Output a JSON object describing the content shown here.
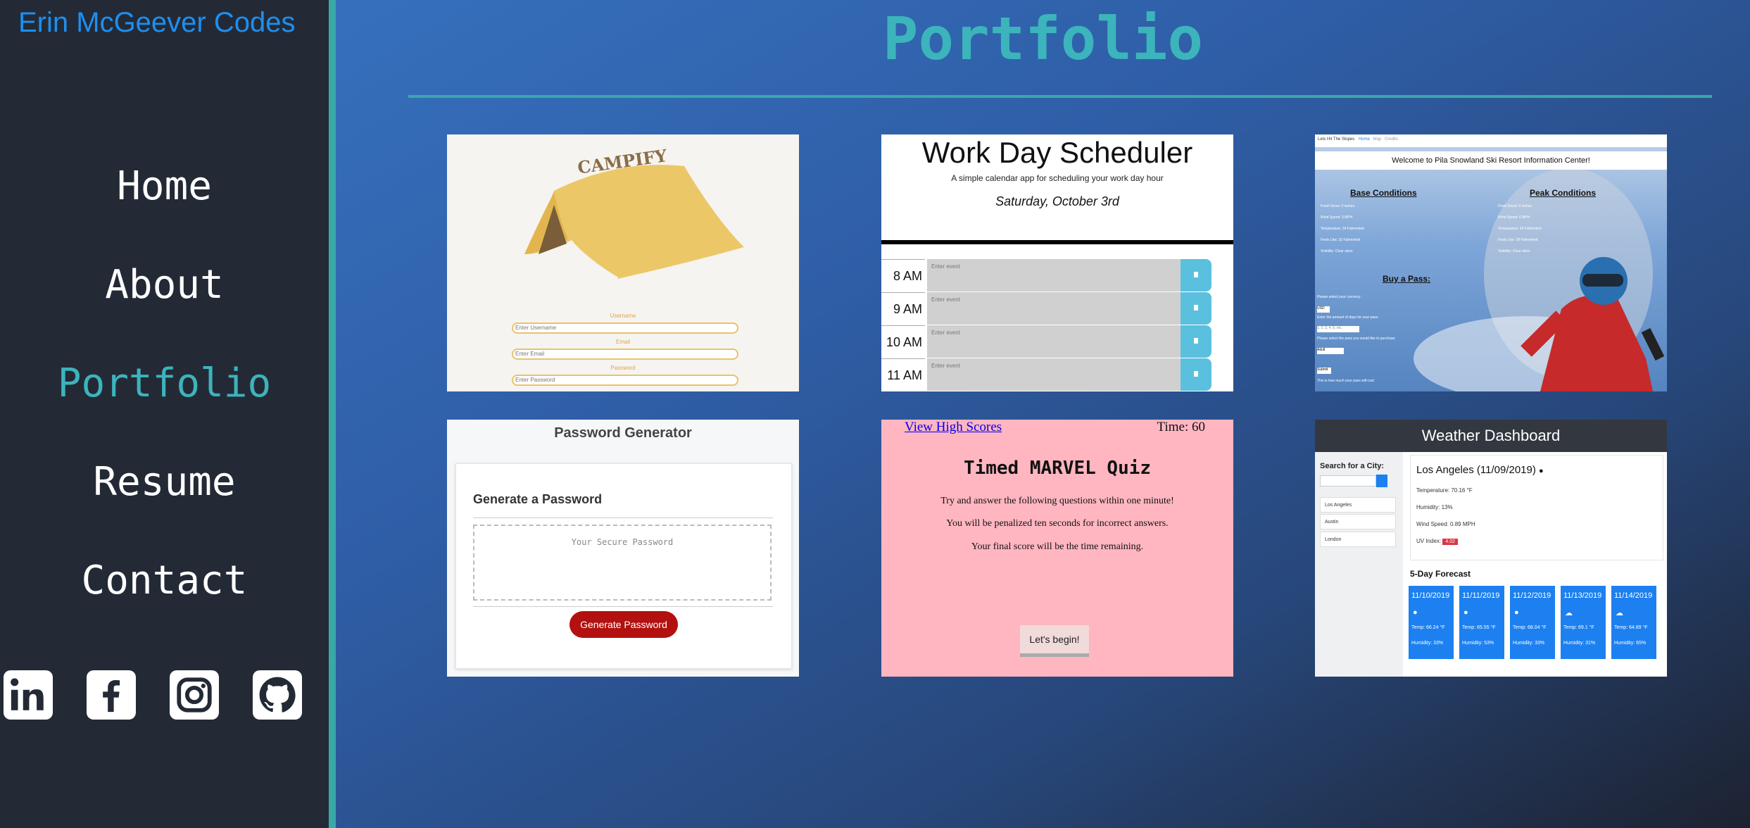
{
  "sidebar": {
    "brand": "Erin McGeever Codes",
    "nav": [
      "Home",
      "About",
      "Portfolio",
      "Resume",
      "Contact"
    ],
    "active": "Portfolio",
    "socials": [
      "linkedin-icon",
      "facebook-icon",
      "instagram-icon",
      "github-icon"
    ]
  },
  "main": {
    "title": "Portfolio"
  },
  "colors": {
    "accent": "#3cb4bc",
    "brand": "#1d8ff0",
    "sidebar_bg": "#232a36"
  },
  "projects": {
    "campify": {
      "logo_text": "CAMPIFY",
      "username_label": "Username",
      "username_placeholder": "Enter Username",
      "email_label": "Email",
      "email_placeholder": "Enter Email",
      "password_label": "Password",
      "password_placeholder": "Enter Password"
    },
    "scheduler": {
      "title": "Work Day Scheduler",
      "subtitle": "A simple calendar app for scheduling your work day hour",
      "date": "Saturday, October 3rd",
      "hours": [
        "8 AM",
        "9 AM",
        "10 AM",
        "11 AM"
      ],
      "event_placeholder": "Enter event"
    },
    "ski": {
      "nav": "Lets Hit The Slopes",
      "nav_links": [
        "Home",
        "Map",
        "Credits"
      ],
      "banner": "Welcome to Pila Snowland Ski Resort Information Center!",
      "base_title": "Base Conditions",
      "base_items": [
        "Fresh Snow: 0 inches",
        "Wind Speed: 3 MPH",
        "Temperature: 34 Fahrenheit",
        "Feels Like: 32 Fahrenheit",
        "Visibility: Clear skies"
      ],
      "peak_title": "Peak Conditions",
      "peak_items": [
        "Fresh Snow: 0 inches",
        "Wind Speed: 6 MPH",
        "Temperature: 43 Fahrenheit",
        "Feels Like: 39 Fahrenheit",
        "Visibility: Clear skies"
      ],
      "pass_title": "Buy a Pass:",
      "pass_lines": [
        "Please select your currency:",
        "Enter the amount of days for your pass:",
        "Please select the pass you would like to purchase:",
        "This is how much your pass will cost:"
      ],
      "currency": "USD",
      "days_placeholder": "1, 2, 3, 4, 5, etc.",
      "pass_type": "Adult",
      "submit": "Submit"
    },
    "password": {
      "title": "Password Generator",
      "heading": "Generate a Password",
      "placeholder": "Your Secure Password",
      "button": "Generate Password"
    },
    "quiz": {
      "high_scores": "View High Scores",
      "time": "Time: 60",
      "title": "Timed MARVEL Quiz",
      "lines": [
        "Try and answer the following questions within one minute!",
        "You will be penalized ten seconds for incorrect answers.",
        "Your final score will be the time remaining."
      ],
      "button": "Let's begin!"
    },
    "weather": {
      "title": "Weather Dashboard",
      "search_label": "Search for a City:",
      "cities": [
        "Los Angeles",
        "Austin",
        "London"
      ],
      "current_city": "Los Angeles (11/09/2019)",
      "temperature": "Temperature: 70.16 °F",
      "humidity": "Humidity: 13%",
      "wind": "Wind Speed: 0.89 MPH",
      "uv_label": "UV Index:",
      "uv_value": "4.02",
      "forecast_title": "5-Day Forecast",
      "forecast": [
        {
          "date": "11/10/2019",
          "icon": "●",
          "temp": "Temp: 66.24 °F",
          "humidity": "Humidity: 33%"
        },
        {
          "date": "11/11/2019",
          "icon": "●",
          "temp": "Temp: 65.55 °F",
          "humidity": "Humidity: 53%"
        },
        {
          "date": "11/12/2019",
          "icon": "●",
          "temp": "Temp: 68.04 °F",
          "humidity": "Humidity: 33%"
        },
        {
          "date": "11/13/2019",
          "icon": "☁",
          "temp": "Temp: 69.1 °F",
          "humidity": "Humidity: 31%"
        },
        {
          "date": "11/14/2019",
          "icon": "☁",
          "temp": "Temp: 64.89 °F",
          "humidity": "Humidity: 65%"
        }
      ]
    }
  }
}
